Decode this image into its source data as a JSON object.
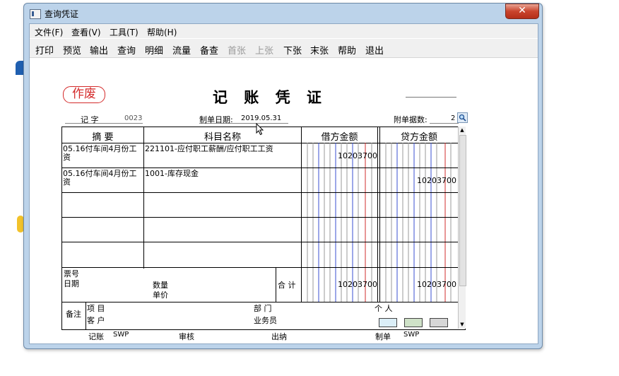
{
  "window": {
    "title": "查询凭证",
    "close_glyph": "✕"
  },
  "menu": [
    "文件(F)",
    "查看(V)",
    "工具(T)",
    "帮助(H)"
  ],
  "toolbar": [
    {
      "label": "打印",
      "enabled": true
    },
    {
      "label": "预览",
      "enabled": true
    },
    {
      "label": "输出",
      "enabled": true
    },
    {
      "label": "查询",
      "enabled": true
    },
    {
      "label": "明细",
      "enabled": true
    },
    {
      "label": "流量",
      "enabled": true
    },
    {
      "label": "备查",
      "enabled": true
    },
    {
      "label": "首张",
      "enabled": false
    },
    {
      "label": "上张",
      "enabled": false
    },
    {
      "label": "下张",
      "enabled": true
    },
    {
      "label": "末张",
      "enabled": true
    },
    {
      "label": "帮助",
      "enabled": true
    },
    {
      "label": "退出",
      "enabled": true
    }
  ],
  "voucher": {
    "stamp": "作废",
    "title": "记 账 凭 证",
    "type_label": "记    字",
    "number": "0023",
    "date_label": "制单日期:",
    "date": "2019.05.31",
    "attach_label": "附单据数:",
    "attach_count": "2",
    "headers": {
      "summary": "摘 要",
      "account": "科目名称",
      "debit": "借方金额",
      "credit": "贷方金额"
    },
    "rows": [
      {
        "summary": "05.16付车间4月份工资",
        "account": "221101-应付职工薪酬/应付职工工资",
        "debit": "10203700",
        "credit": ""
      },
      {
        "summary": "05.16付车间4月份工资",
        "account": "1001-库存现金",
        "debit": "",
        "credit": "10203700"
      },
      {
        "summary": "",
        "account": "",
        "debit": "",
        "credit": ""
      },
      {
        "summary": "",
        "account": "",
        "debit": "",
        "credit": ""
      },
      {
        "summary": "",
        "account": "",
        "debit": "",
        "credit": ""
      }
    ],
    "footer": {
      "ticket_no_label": "票号",
      "date_label": "日期",
      "quantity_label": "数量",
      "unit_price_label": "单价",
      "total_label": "合 计",
      "total_debit": "10203700",
      "total_credit": "10203700",
      "remark_label": "备注",
      "project_label": "项  目",
      "customer_label": "客  户",
      "department_label": "部  门",
      "salesperson_label": "业务员",
      "person_label": "个  人"
    },
    "signatures": {
      "bookkeeper_label": "记账",
      "bookkeeper": "SWP",
      "review_label": "审核",
      "cashier_label": "出纳",
      "maker_label": "制单",
      "maker": "SWP"
    }
  },
  "colors": {
    "stamp_red": "#d42a2a",
    "column_blue": "#3a4fd0",
    "column_red": "#d02c2c",
    "column_gray": "#9a9a9a"
  }
}
